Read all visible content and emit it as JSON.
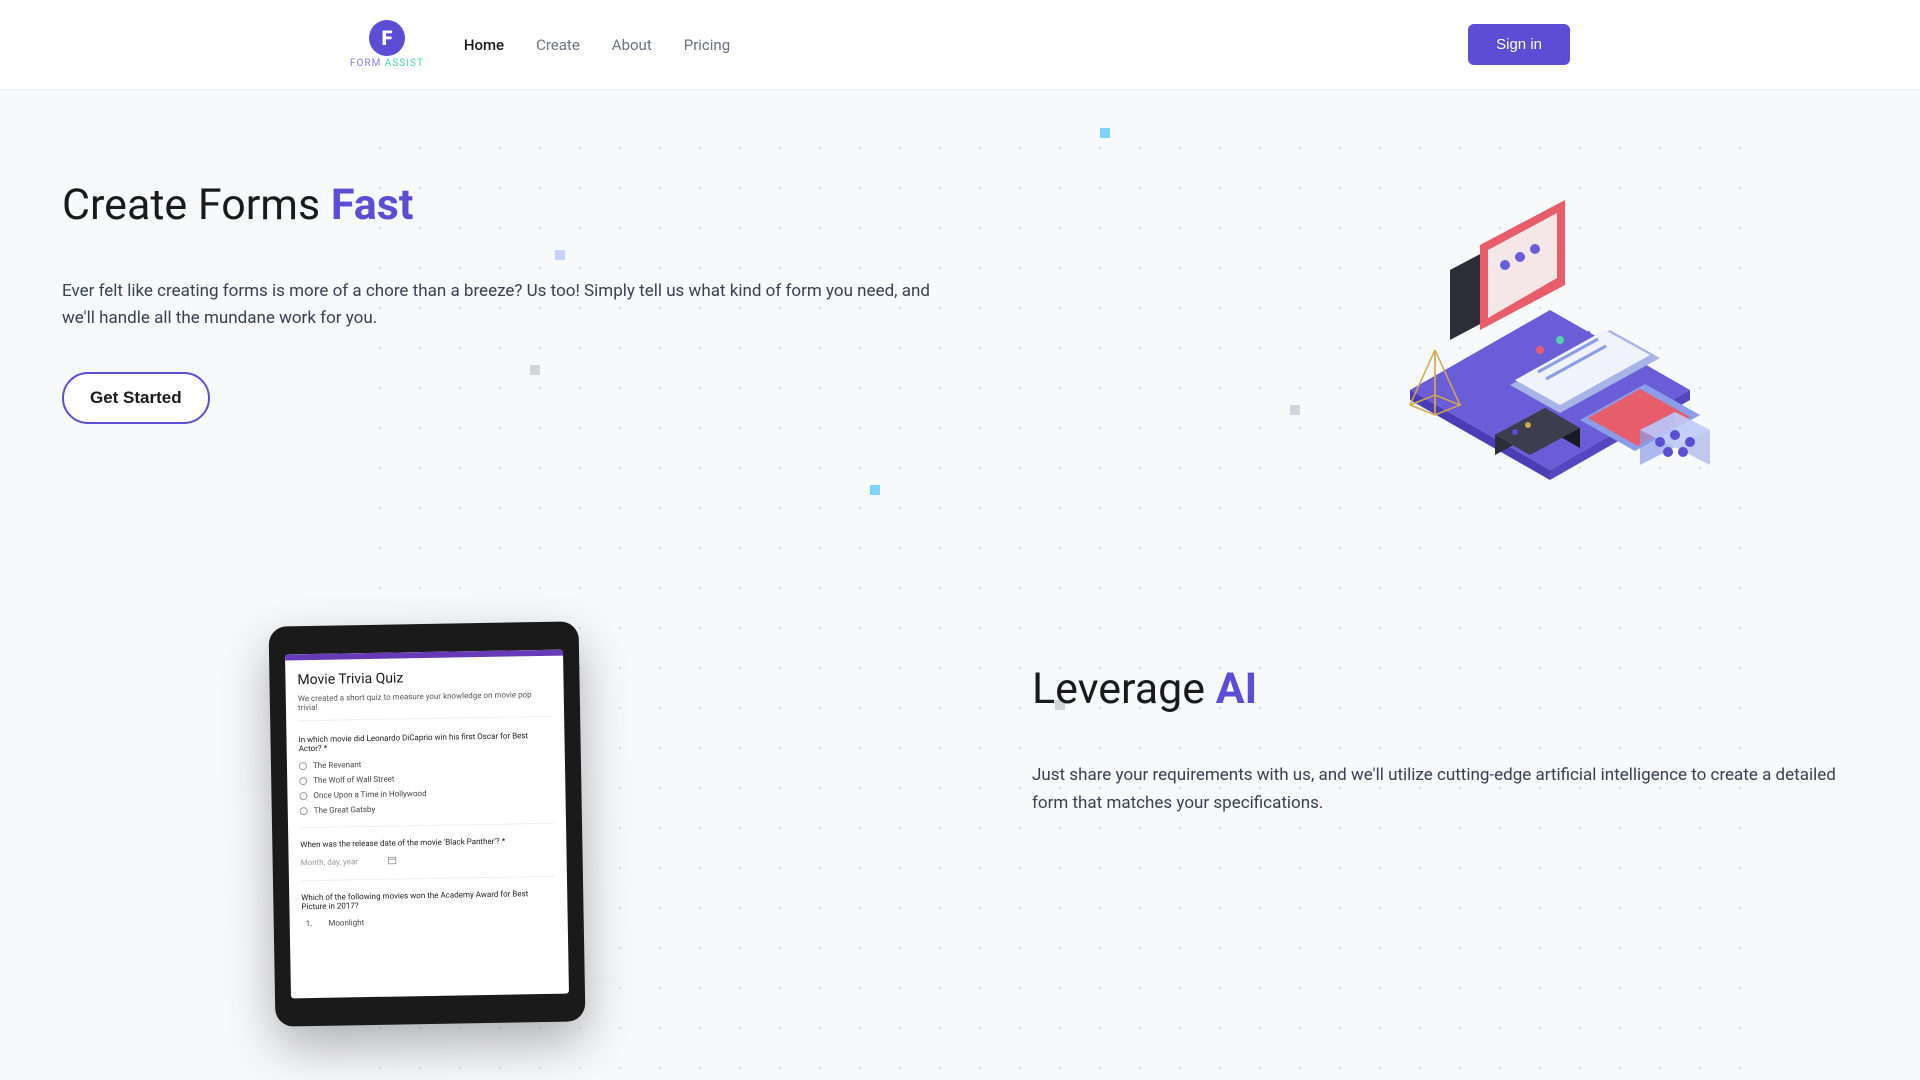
{
  "header": {
    "logo": {
      "form": "FORM",
      "assist": "ASSIST"
    },
    "nav": [
      {
        "label": "Home",
        "active": true
      },
      {
        "label": "Create",
        "active": false
      },
      {
        "label": "About",
        "active": false
      },
      {
        "label": "Pricing",
        "active": false
      }
    ],
    "signin": "Sign in"
  },
  "hero1": {
    "title_prefix": "Create Forms ",
    "title_accent": "Fast",
    "description": "Ever felt like creating forms is more of a chore than a breeze? Us too! Simply tell us what kind of form you need, and we'll handle all the mundane work for you.",
    "cta": "Get Started"
  },
  "hero2": {
    "title_prefix": "Leverage ",
    "title_accent": "AI",
    "description": "Just share your requirements with us, and we'll utilize cutting-edge artificial intelligence to create a detailed form that matches your specifications."
  },
  "tablet": {
    "title": "Movie Trivia Quiz",
    "desc": "We created a short quiz to measure your knowledge on movie pop trivia!",
    "q1": "In which movie did Leonardo DiCaprio win his first Oscar for Best Actor? *",
    "opts": [
      "The Revenant",
      "The Wolf of Wall Street",
      "Once Upon a Time in Hollywood",
      "The Great Gatsby"
    ],
    "q2": "When was the release date of the movie 'Black Panther'? *",
    "date_placeholder": "Month, day, year",
    "q3": "Which of the following movies won the Academy Award for Best Picture in 2017?",
    "q3_opt": "Moonlight"
  }
}
